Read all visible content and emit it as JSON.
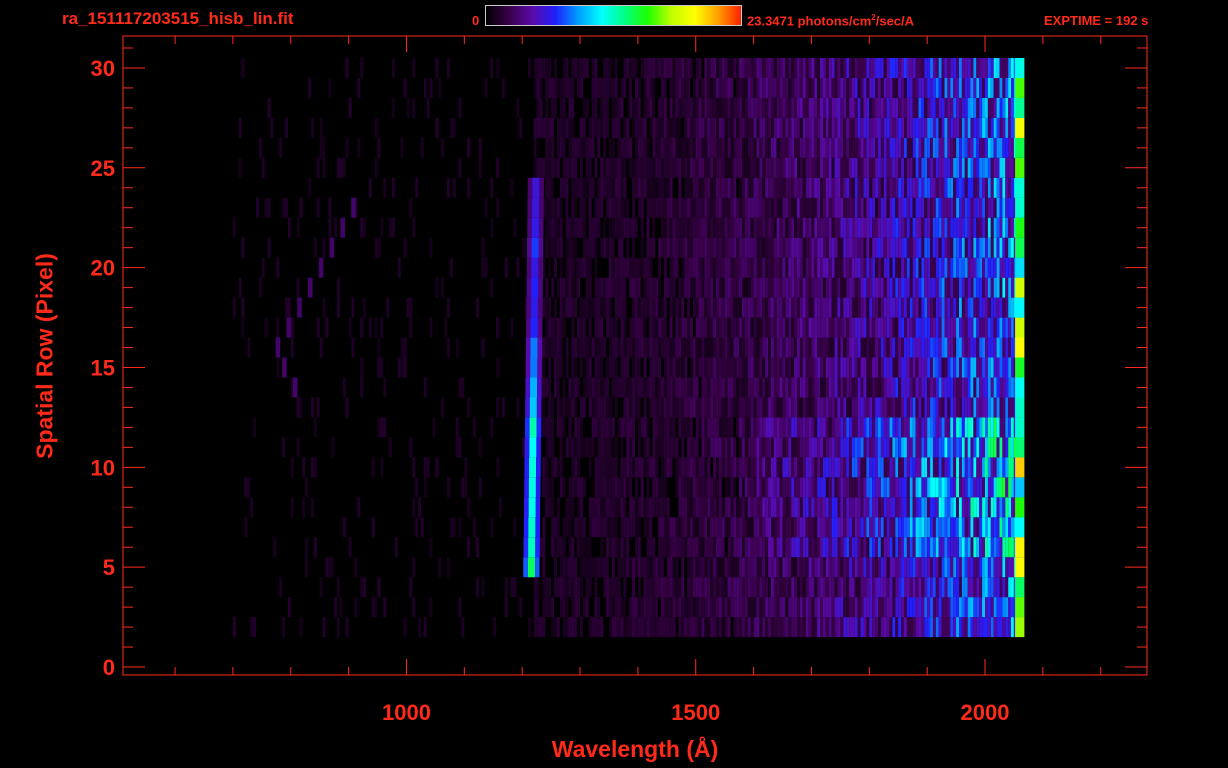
{
  "header": {
    "file_title": "ra_151117203515_hisb_lin.fit",
    "colorbar_min": "0",
    "colorbar_max_value": "23.3471",
    "colorbar_unit_pre": " photons/cm",
    "colorbar_unit_sup": "2",
    "colorbar_unit_post": "/sec/A",
    "exptime": "EXPTIME = 192 s"
  },
  "colors": {
    "text": "#ff2a1a",
    "axes": "#ff2a1a",
    "background": "#000000",
    "colormap": [
      "#000000",
      "#3a004a",
      "#5a0aa8",
      "#2020ff",
      "#00a0ff",
      "#00ffff",
      "#00ff80",
      "#20ff00",
      "#c0ff00",
      "#ffff00",
      "#ffa000",
      "#ff2000"
    ]
  },
  "chart_data": {
    "type": "heatmap",
    "xlabel": "Wavelength (Å)",
    "ylabel": "Spatial Row (Pixel)",
    "xlim": [
      510,
      2280
    ],
    "ylim": [
      -0.4,
      31.6
    ],
    "x_ticks": [
      1000,
      1500,
      2000
    ],
    "y_ticks": [
      0,
      5,
      10,
      15,
      20,
      25,
      30
    ],
    "x_minor_step": 100,
    "y_minor_step": 1,
    "color_scale": {
      "min": 0,
      "max": 23.3471,
      "unit": "photons/cm²/sec/A"
    },
    "features": [
      {
        "type": "emission_line",
        "wavelength": 1216,
        "row_min": 5,
        "row_max": 24,
        "peak_row": 7.5,
        "peak_relative": 0.6
      },
      {
        "type": "arc",
        "wavelength_min": 770,
        "wavelength_max": 910,
        "row_min": 14,
        "row_max": 23,
        "relative": 0.12
      },
      {
        "type": "continuum",
        "wavelength_min": 1220,
        "wavelength_max": 2060,
        "row_min": 2,
        "row_max": 30,
        "relative_low": 0.05,
        "relative_high": 0.35
      },
      {
        "type": "band_edge",
        "wavelength": 2060,
        "row_min": 2,
        "row_max": 30,
        "relative": 0.85
      }
    ]
  }
}
